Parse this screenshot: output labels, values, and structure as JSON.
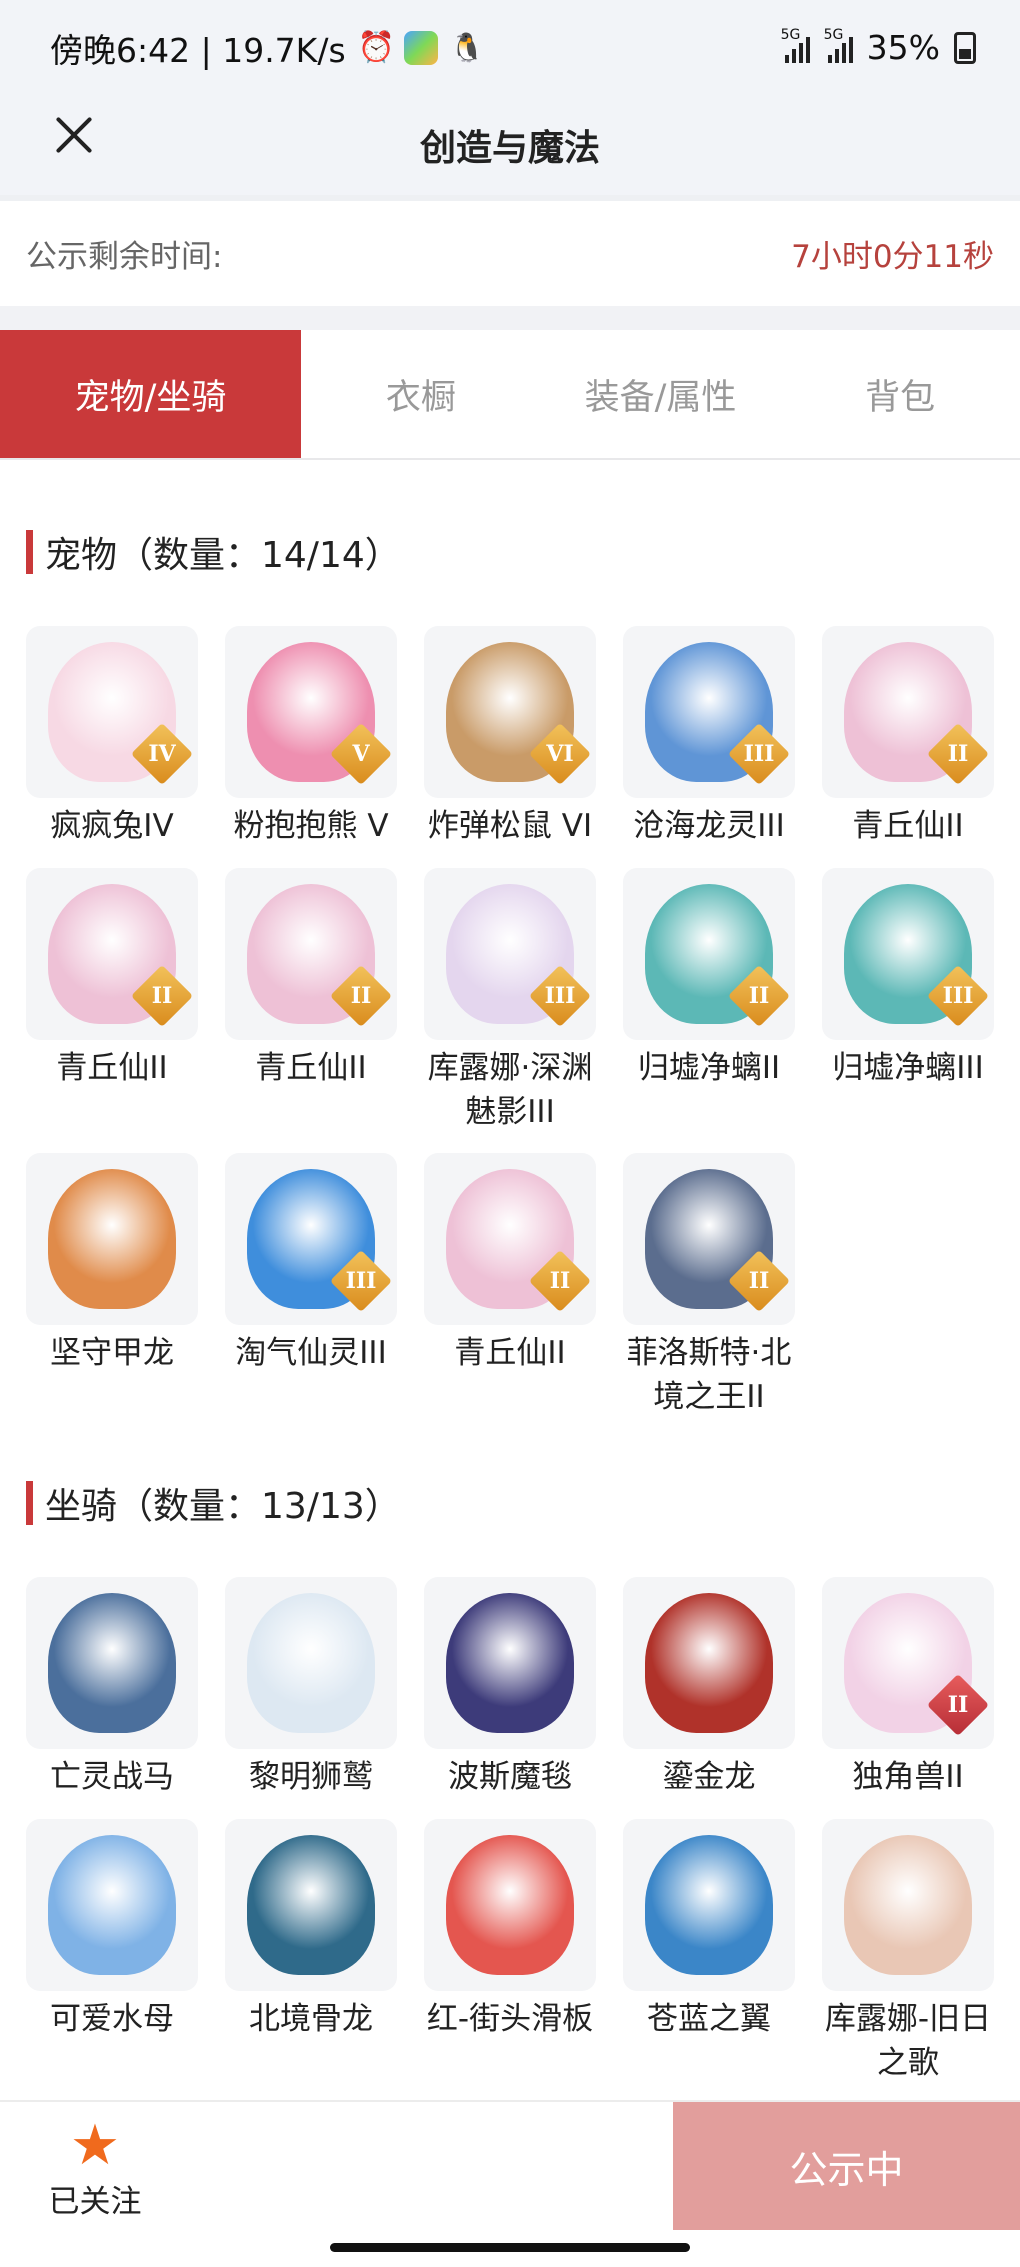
{
  "statusbar": {
    "left_text": "傍晚6:42 | 19.7K/s",
    "battery": "35%",
    "net1": "5G",
    "net2": "5G"
  },
  "header": {
    "title": "创造与魔法"
  },
  "notice": {
    "label": "公示剩余时间:",
    "time": "7小时0分11秒"
  },
  "tabs": [
    {
      "label": "宠物/坐骑",
      "active": true
    },
    {
      "label": "衣橱"
    },
    {
      "label": "装备/属性"
    },
    {
      "label": "背包"
    }
  ],
  "pets": {
    "title": "宠物（数量：14/14）",
    "items": [
      {
        "name": "疯疯兔IV",
        "badge": "IV",
        "color": "#f7d9e4"
      },
      {
        "name": "粉抱抱熊 V",
        "badge": "V",
        "color": "#ee8fb0"
      },
      {
        "name": "炸弹松鼠 VI",
        "badge": "VI",
        "color": "#c99b68"
      },
      {
        "name": "沧海龙灵III",
        "badge": "III",
        "color": "#5f95d6"
      },
      {
        "name": "青丘仙II",
        "badge": "II",
        "color": "#eec1d6"
      },
      {
        "name": "青丘仙II",
        "badge": "II",
        "color": "#eec1d6"
      },
      {
        "name": "青丘仙II",
        "badge": "II",
        "color": "#eec1d6"
      },
      {
        "name": "库露娜·深渊魅影III",
        "badge": "III",
        "color": "#e4d6ee"
      },
      {
        "name": "归墟净螭II",
        "badge": "II",
        "color": "#5cb8b6"
      },
      {
        "name": "归墟净螭III",
        "badge": "III",
        "color": "#5cb8b6"
      },
      {
        "name": "坚守甲龙",
        "badge": "",
        "color": "#e08b4a"
      },
      {
        "name": "淘气仙灵III",
        "badge": "III",
        "color": "#3f8edc"
      },
      {
        "name": "青丘仙II",
        "badge": "II",
        "color": "#eec1d6"
      },
      {
        "name": "菲洛斯特·北境之王II",
        "badge": "II",
        "color": "#5b6d8e"
      }
    ]
  },
  "mounts": {
    "title": "坐骑（数量：13/13）",
    "items": [
      {
        "name": "亡灵战马",
        "badge": "",
        "color": "#4b6f9c"
      },
      {
        "name": "黎明狮鹫",
        "badge": "",
        "color": "#dde8f2"
      },
      {
        "name": "波斯魔毯",
        "badge": "",
        "color": "#3d3b7a"
      },
      {
        "name": "鎏金龙",
        "badge": "",
        "color": "#b0322a"
      },
      {
        "name": "独角兽II",
        "badge": "II",
        "color": "#f2d2e6",
        "badge_style": "red"
      },
      {
        "name": "可爱水母",
        "badge": "",
        "color": "#7fb2e6"
      },
      {
        "name": "北境骨龙",
        "badge": "",
        "color": "#2f6a8a"
      },
      {
        "name": "红-街头滑板",
        "badge": "",
        "color": "#e4564f"
      },
      {
        "name": "苍蓝之翼",
        "badge": "",
        "color": "#3b86c8"
      },
      {
        "name": "库露娜-旧日之歌",
        "badge": "",
        "color": "#e9c7b5"
      }
    ]
  },
  "bottom": {
    "follow_label": "已关注",
    "public_button": "公示中"
  }
}
